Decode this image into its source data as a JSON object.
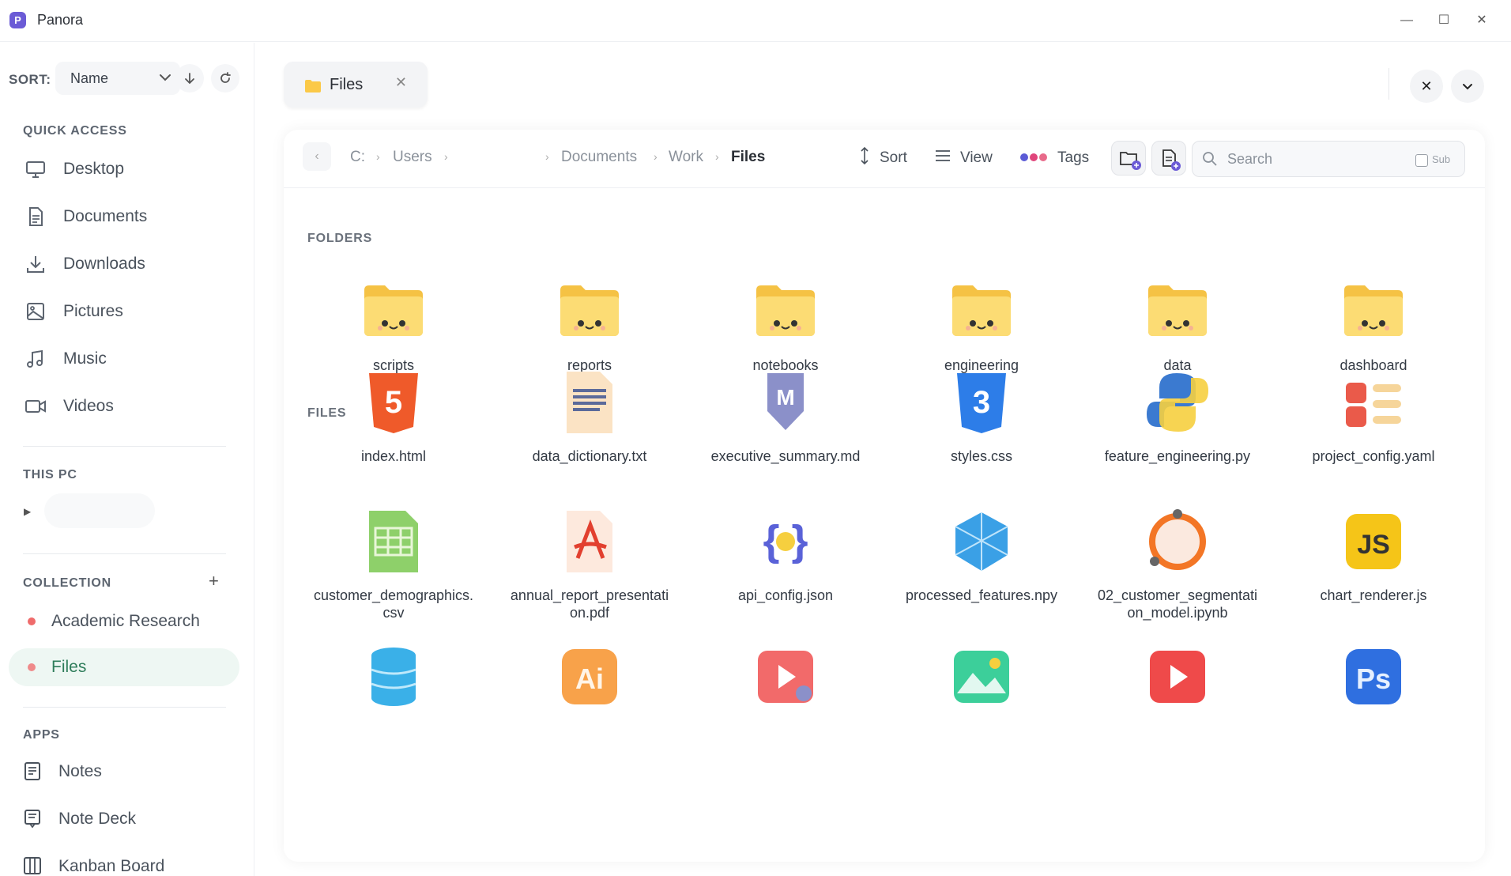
{
  "window": {
    "app_title": "Panora",
    "logo_letter": "P",
    "minimize": "—",
    "maximize": "☐",
    "close": "✕"
  },
  "sidebar": {
    "sort": {
      "label": "SORT:",
      "value": "Name"
    },
    "quick_access": {
      "title": "QUICK ACCESS",
      "items": [
        {
          "label": "Desktop",
          "icon": "monitor-icon"
        },
        {
          "label": "Documents",
          "icon": "document-icon"
        },
        {
          "label": "Downloads",
          "icon": "download-icon"
        },
        {
          "label": "Pictures",
          "icon": "image-icon"
        },
        {
          "label": "Music",
          "icon": "music-icon"
        },
        {
          "label": "Videos",
          "icon": "video-icon"
        }
      ]
    },
    "this_pc": {
      "title": "THIS PC"
    },
    "collection": {
      "title": "COLLECTION",
      "items": [
        {
          "label": "Academic Research",
          "color": "#ef6b6b"
        },
        {
          "label": "Files",
          "color": "#ef8a8a",
          "active": true
        }
      ]
    },
    "apps": {
      "title": "APPS",
      "items": [
        {
          "label": "Notes",
          "icon": "notes-icon"
        },
        {
          "label": "Note Deck",
          "icon": "note-deck-icon"
        },
        {
          "label": "Kanban Board",
          "icon": "kanban-icon"
        }
      ]
    }
  },
  "tabs": [
    {
      "label": "Files"
    }
  ],
  "breadcrumb": {
    "drive": "C:",
    "users": "Users",
    "documents": "Documents",
    "work": "Work",
    "current": "Files"
  },
  "toolbar": {
    "sort_label": "Sort",
    "view_label": "View",
    "tags_label": "Tags",
    "search_placeholder": "Search",
    "sub_label": "Sub"
  },
  "sections": {
    "folders": "FOLDERS",
    "files": "FILES"
  },
  "folders": [
    "scripts",
    "reports",
    "notebooks",
    "engineering",
    "data",
    "dashboard"
  ],
  "files": [
    {
      "name": "index.html",
      "icon": "html5-icon"
    },
    {
      "name": "data_dictionary.txt",
      "icon": "text-file-icon"
    },
    {
      "name": "executive_summary.md",
      "icon": "markdown-icon"
    },
    {
      "name": "styles.css",
      "icon": "css3-icon"
    },
    {
      "name": "feature_engineering.py",
      "icon": "python-icon"
    },
    {
      "name": "project_config.yaml",
      "icon": "yaml-icon"
    },
    {
      "name": "customer_demographics.csv",
      "icon": "csv-icon"
    },
    {
      "name": "annual_report_presentation.pdf",
      "icon": "pdf-icon"
    },
    {
      "name": "api_config.json",
      "icon": "json-icon"
    },
    {
      "name": "processed_features.npy",
      "icon": "numpy-icon"
    },
    {
      "name": "02_customer_segmentation_model.ipynb",
      "icon": "jupyter-icon"
    },
    {
      "name": "chart_renderer.js",
      "icon": "javascript-icon"
    },
    {
      "name": "",
      "icon": "database-icon"
    },
    {
      "name": "",
      "icon": "illustrator-icon"
    },
    {
      "name": "",
      "icon": "video-settings-icon"
    },
    {
      "name": "",
      "icon": "image-file-icon"
    },
    {
      "name": "",
      "icon": "video-file-icon"
    },
    {
      "name": "",
      "icon": "photoshop-icon"
    }
  ],
  "colors": {
    "folder": "#fbd86a",
    "accent": "#6b5bd6",
    "active_bg": "#eef7f3",
    "active_text": "#2f7d5b"
  }
}
